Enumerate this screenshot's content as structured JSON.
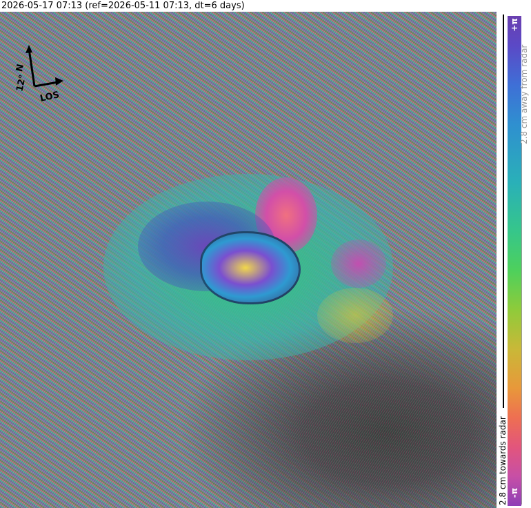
{
  "title": "2026-05-17 07:13 (ref=2026-05-11 07:13, dt=6 days)",
  "north_arrow": {
    "north_label": "N",
    "angle_label": "12°",
    "los_label": "LOS"
  },
  "colorbar": {
    "top_label": "+π",
    "bottom_label": "-π",
    "away_text": "2.8 cm away from radar",
    "towards_text": "2.8 cm towards radar"
  },
  "colors": {
    "background": "#ffffff",
    "text": "#000000",
    "away_axis": "#999999"
  }
}
